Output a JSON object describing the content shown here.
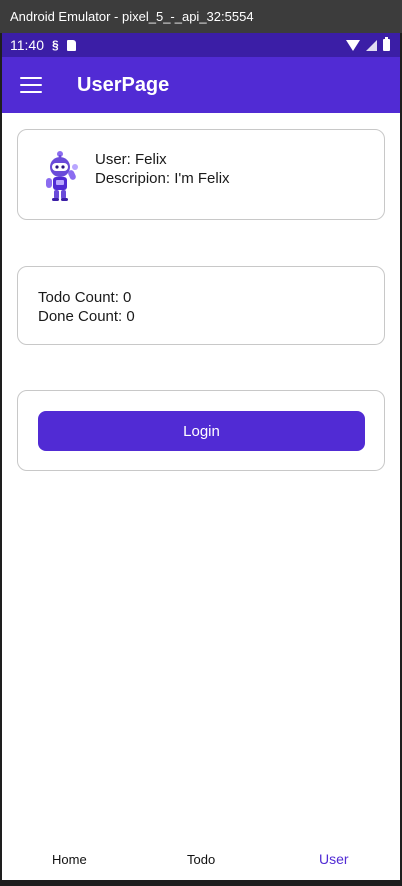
{
  "window": {
    "title": "Android Emulator - pixel_5_-_api_32:5554"
  },
  "status_bar": {
    "time": "11:40",
    "icons": [
      "sync-icon",
      "sd-card-icon",
      "wifi-icon",
      "signal-icon",
      "battery-icon"
    ]
  },
  "app_bar": {
    "title": "UserPage",
    "menu_icon": "hamburger-icon"
  },
  "user_card": {
    "avatar_icon": "dotnet-bot-icon",
    "user_line": "User: Felix",
    "description_line": "Descripion: I'm Felix"
  },
  "stats_card": {
    "todo_count": "Todo Count: 0",
    "done_count": "Done Count: 0"
  },
  "login_card": {
    "button_label": "Login"
  },
  "tabs": [
    {
      "label": "Home",
      "selected": false
    },
    {
      "label": "Todo",
      "selected": false
    },
    {
      "label": "User",
      "selected": true
    }
  ],
  "colors": {
    "primary": "#512bd4",
    "status_bar": "#3b1ea6",
    "card_border": "#c8c8c8"
  }
}
